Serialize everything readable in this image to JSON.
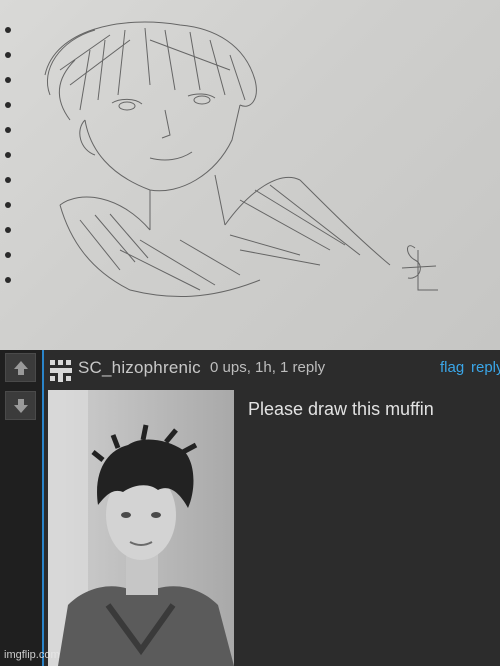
{
  "comment": {
    "username": "SC_hizophrenic",
    "meta": "0 ups, 1h, 1 reply",
    "actions": {
      "flag": "flag",
      "reply": "reply"
    },
    "text": "Please draw this muffin"
  },
  "watermark": "imgflip.com",
  "colors": {
    "link": "#3aa6e8",
    "vote_border": "#2a84c9",
    "background": "#2c2c2c"
  },
  "icons": {
    "upvote": "arrow-up-icon",
    "downvote": "arrow-down-icon",
    "avatar": "pixel-avatar-icon"
  }
}
